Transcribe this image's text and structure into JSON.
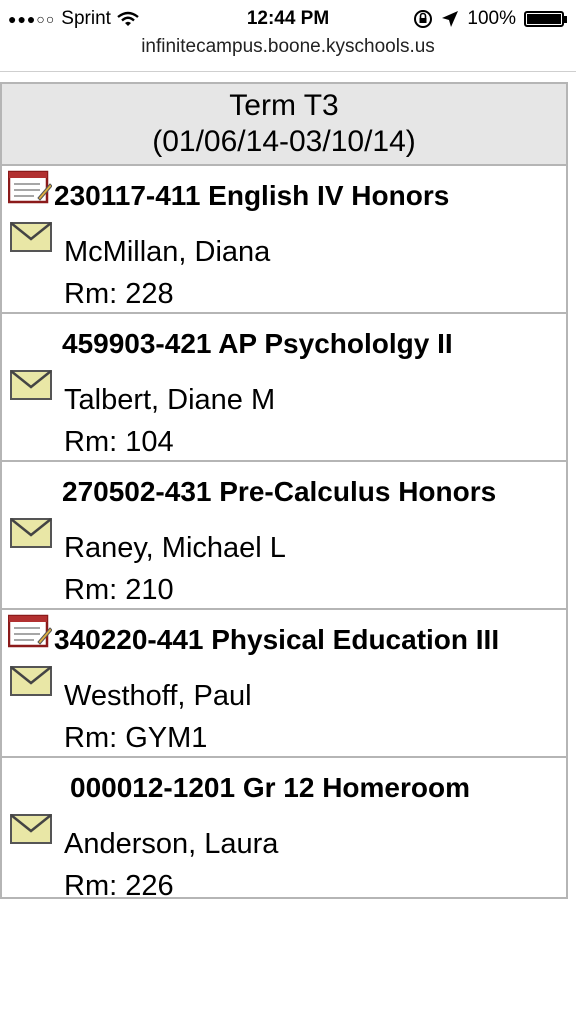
{
  "status_bar": {
    "signal_dots": "●●●○○",
    "carrier": "Sprint",
    "time": "12:44 PM",
    "battery": "100%"
  },
  "url": "infinitecampus.boone.kyschools.us",
  "term": {
    "name": "Term T3",
    "dates": "(01/06/14-03/10/14)"
  },
  "courses": [
    {
      "title": "230117-411 English IV Honors",
      "teacher": "McMillan, Diana",
      "room": "Rm: 228"
    },
    {
      "title": "459903-421 AP Psychololgy II",
      "teacher": "Talbert, Diane M",
      "room": "Rm: 104"
    },
    {
      "title": "270502-431 Pre-Calculus Honors",
      "teacher": "Raney, Michael L",
      "room": "Rm: 210"
    },
    {
      "title": "340220-441 Physical Education III",
      "teacher": "Westhoff, Paul",
      "room": "Rm: GYM1"
    },
    {
      "title": "000012-1201 Gr 12 Homeroom",
      "teacher": "Anderson, Laura",
      "room": "Rm: 226"
    }
  ],
  "icons": {
    "notebook": "notebook-icon",
    "mail": "mail-icon"
  },
  "colors": {
    "header_bg": "#e6e6e6",
    "border": "#b5b5b5",
    "mail_fill": "#e9e7a6"
  }
}
